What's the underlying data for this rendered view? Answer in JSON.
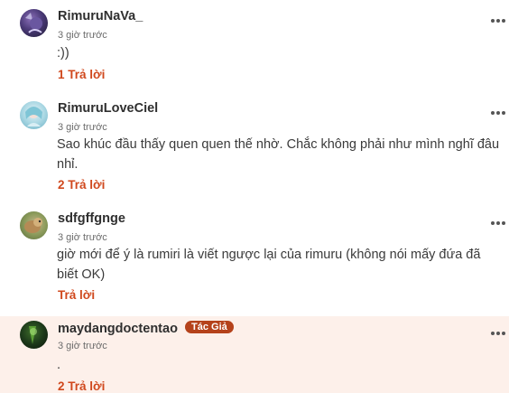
{
  "comments": [
    {
      "username": "RimuruNaVa_",
      "time": "3 giờ trước",
      "text": ":))",
      "reply_label": "1 Trả lời",
      "avatar_icon": "user-avatar",
      "more_icon": "more-options-icon"
    },
    {
      "username": "RimuruLoveCiel",
      "time": "3 giờ trước",
      "text": "Sao khúc đầu thấy quen quen thế nhờ. Chắc không phải như mình nghĩ đâu nhỉ.",
      "reply_label": "2 Trả lời",
      "avatar_icon": "user-avatar",
      "more_icon": "more-options-icon"
    },
    {
      "username": "sdfgffgnge",
      "time": "3 giờ trước",
      "text": "giờ mới để ý là rumiri là viết ngược lại của rimuru (không nói mấy đứa đã biết OK)",
      "reply_label": "Trả lời",
      "avatar_icon": "user-avatar",
      "more_icon": "more-options-icon"
    },
    {
      "username": "maydangdoctentao",
      "badge": "Tác Giả",
      "time": "3 giờ trước",
      "text": ".",
      "reply_label": "2 Trả lời",
      "avatar_icon": "user-avatar",
      "more_icon": "more-options-icon"
    }
  ],
  "colors": {
    "reply": "#d0481d",
    "badge_bg": "#b5421b",
    "author_highlight_bg": "#fdf0ea"
  }
}
